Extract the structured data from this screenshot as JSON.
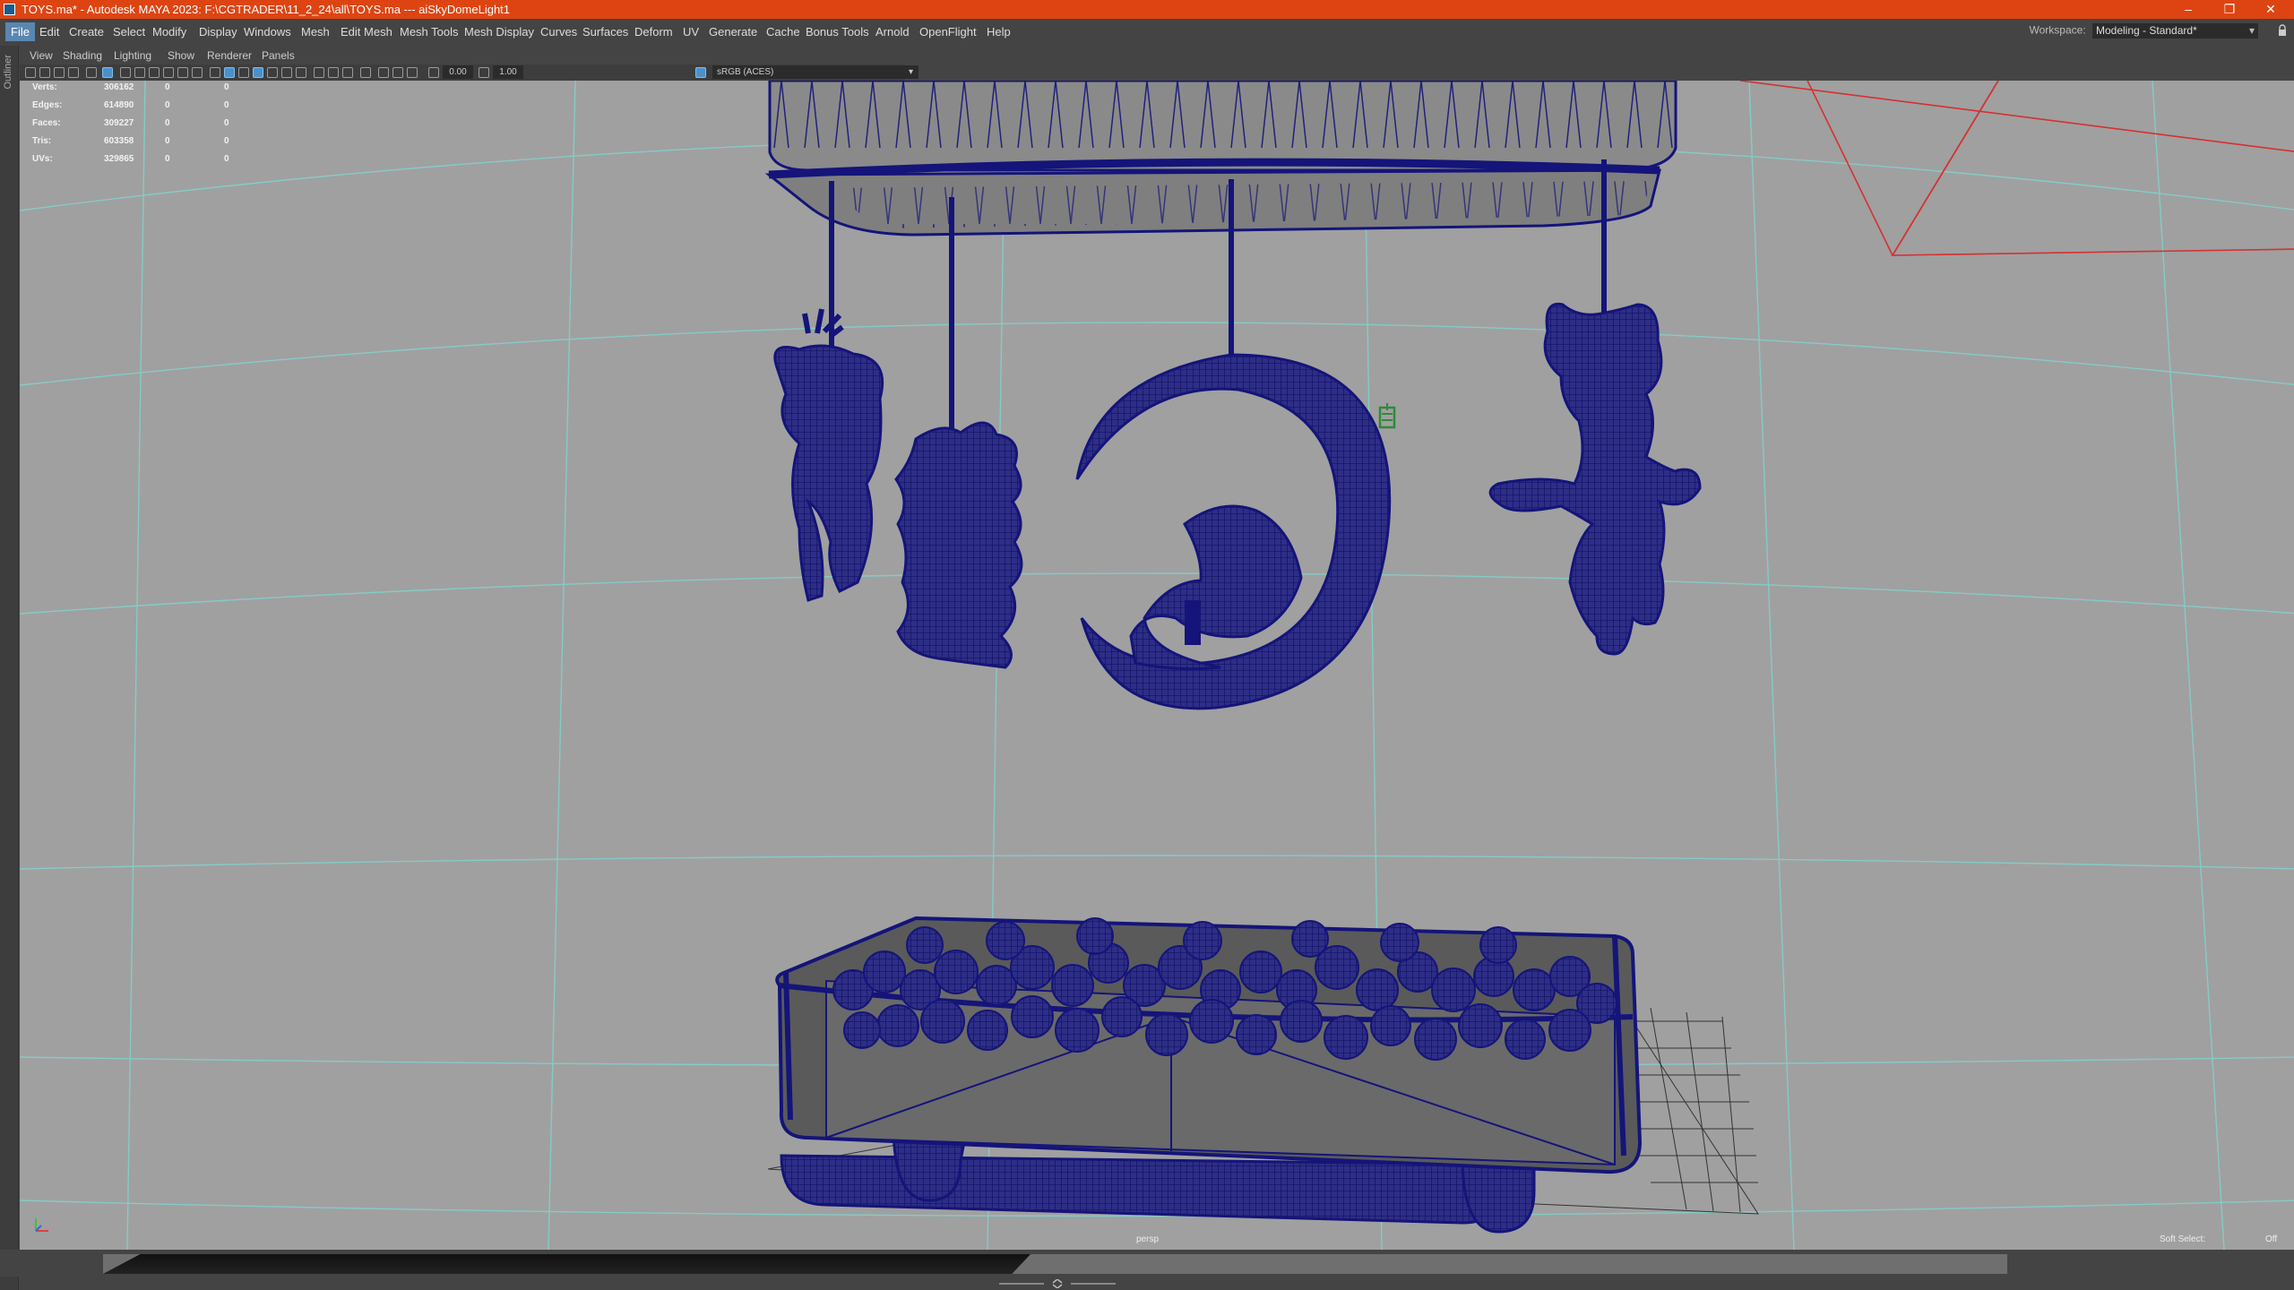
{
  "window": {
    "title": "TOYS.ma* - Autodesk MAYA 2023: F:\\CGTRADER\\11_2_24\\all\\TOYS.ma   ---   aiSkyDomeLight1",
    "minimize": "–",
    "restore": "❐",
    "close": "✕"
  },
  "menubar": {
    "items": [
      "File",
      "Edit",
      "Create",
      "Select",
      "Modify",
      "Display",
      "Windows",
      "Mesh",
      "Edit Mesh",
      "Mesh Tools",
      "Mesh Display",
      "Curves",
      "Surfaces",
      "Deform",
      "UV",
      "Generate",
      "Cache",
      "Bonus Tools",
      "Arnold",
      "OpenFlight",
      "Help"
    ],
    "active": "File",
    "workspace_label": "Workspace:",
    "workspace_value": "Modeling - Standard*"
  },
  "outliner": {
    "label": "Outliner"
  },
  "panel_menu": [
    "View",
    "Shading",
    "Lighting",
    "Show",
    "Renderer",
    "Panels"
  ],
  "toolbar": {
    "exposure": "0.00",
    "gamma": "1.00",
    "color_space": "sRGB (ACES)"
  },
  "hud": {
    "stats": [
      {
        "label": "Verts:",
        "value": "306162",
        "sel": "0",
        "comp": "0"
      },
      {
        "label": "Edges:",
        "value": "614890",
        "sel": "0",
        "comp": "0"
      },
      {
        "label": "Faces:",
        "value": "309227",
        "sel": "0",
        "comp": "0"
      },
      {
        "label": "Tris:",
        "value": "603358",
        "sel": "0",
        "comp": "0"
      },
      {
        "label": "UVs:",
        "value": "329865",
        "sel": "0",
        "comp": "0"
      }
    ],
    "camera": "persp",
    "soft_select_label": "Soft Select:",
    "soft_select_value": "Off"
  },
  "colors": {
    "title_bar": "#de4412",
    "viewport_bg": "#a0a0a0",
    "wireframe": "#14147a",
    "grid": "#7fd6d0",
    "camera_frustum": "#d63030",
    "accent": "#5a86b0"
  }
}
